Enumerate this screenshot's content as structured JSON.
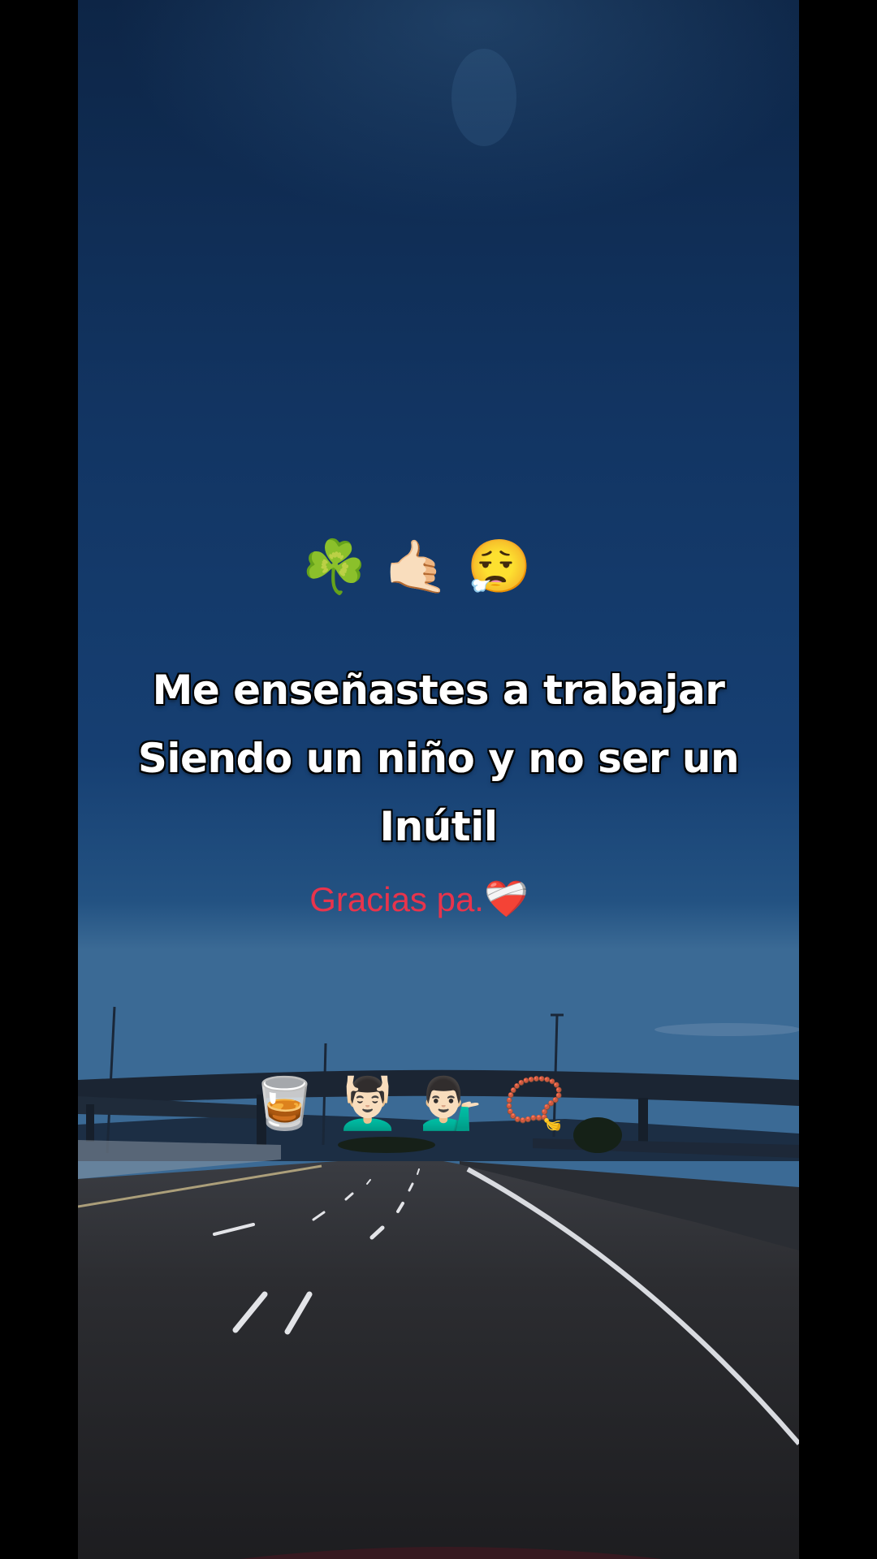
{
  "overlay": {
    "top_emojis": [
      "☘️",
      "🤙🏻",
      "😮‍💨"
    ],
    "top_emoji_names": [
      "shamrock-icon",
      "call-me-hand-icon",
      "exhale-face-icon"
    ],
    "caption_lines": [
      "Me enseñastes a trabajar",
      "Siendo un niño y no ser un",
      "Inútil"
    ],
    "thanks_text": "Gracias pa.",
    "thanks_emoji": "❤️‍🩹",
    "bottom_emojis": [
      "🥃",
      "💆🏻‍♂️",
      "💁🏻‍♂️",
      "📿"
    ],
    "bottom_emoji_names": [
      "whiskey-glass-icon",
      "head-massage-icon",
      "tipping-hand-person-icon",
      "prayer-beads-icon"
    ]
  },
  "colors": {
    "sky_top": "#0f2a4c",
    "sky_mid": "#143c6c",
    "sky_horizon": "#2b5a88",
    "road": "#2b2b2e",
    "thanks_text": "#e8344c",
    "caption_text": "#ffffff",
    "caption_outline": "#000000"
  }
}
